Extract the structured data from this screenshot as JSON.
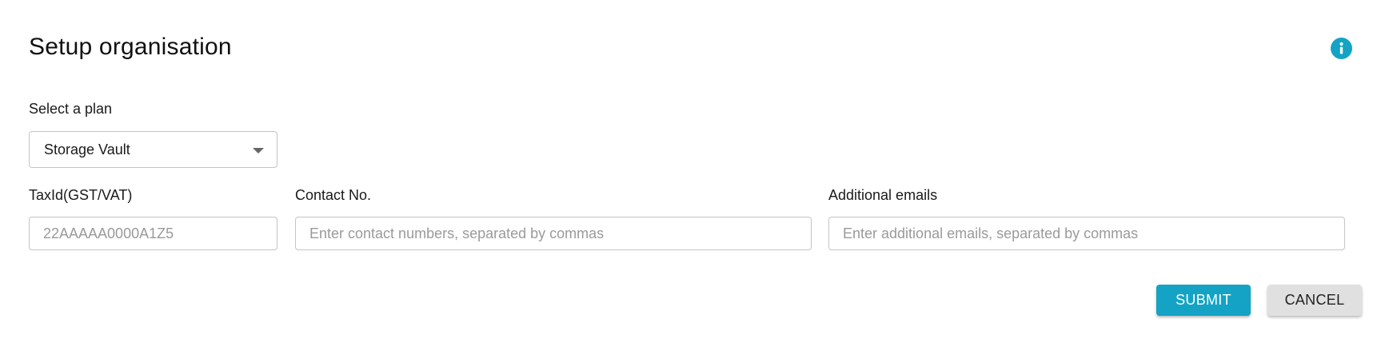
{
  "header": {
    "title": "Setup organisation",
    "info_icon": "info-icon",
    "accent_color": "#14a3c4"
  },
  "plan": {
    "label": "Select a plan",
    "selected": "Storage Vault",
    "caret_icon": "caret-down-icon"
  },
  "fields": {
    "tax": {
      "label": "TaxId(GST/VAT)",
      "value": "",
      "placeholder": "22AAAAA0000A1Z5"
    },
    "contact": {
      "label": "Contact No.",
      "value": "",
      "placeholder": "Enter contact numbers, separated by commas"
    },
    "emails": {
      "label": "Additional emails",
      "value": "",
      "placeholder": "Enter additional emails, separated by commas"
    }
  },
  "actions": {
    "submit_label": "SUBMIT",
    "cancel_label": "CANCEL",
    "submit_color": "#14a3c4",
    "cancel_color": "#e0e0e0"
  }
}
